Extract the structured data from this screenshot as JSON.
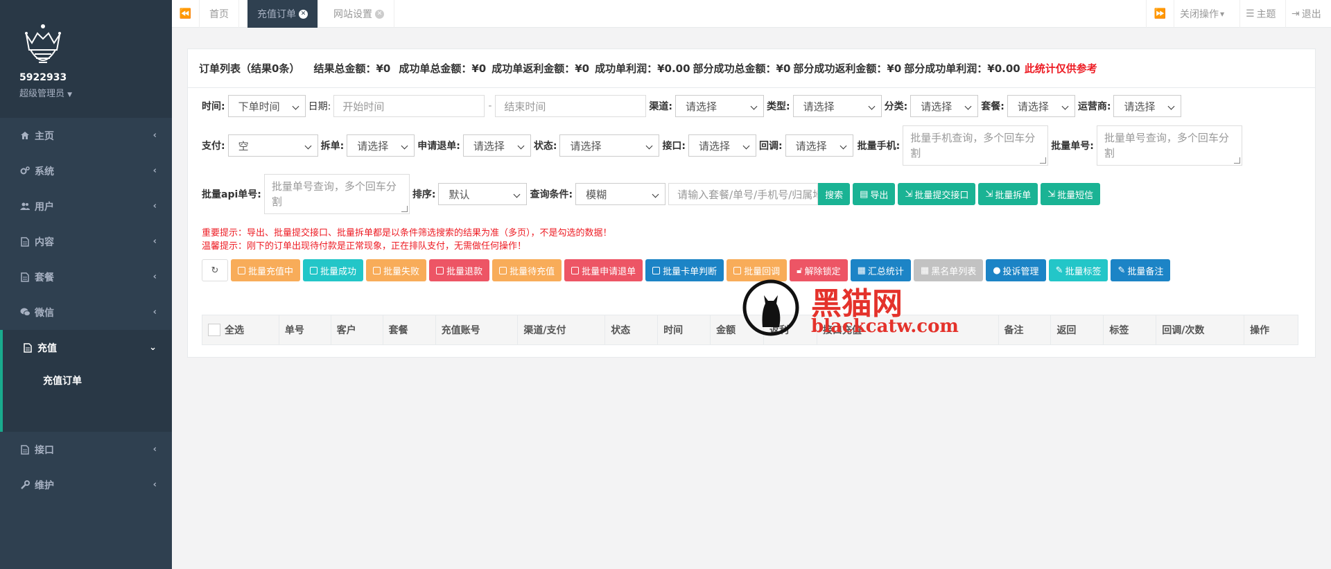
{
  "sidebar": {
    "username": "5922933",
    "role": "超级管理员",
    "items": [
      {
        "label": "主页",
        "icon": "home-icon"
      },
      {
        "label": "系统",
        "icon": "cogs-icon"
      },
      {
        "label": "用户",
        "icon": "users-icon"
      },
      {
        "label": "内容",
        "icon": "file-icon"
      },
      {
        "label": "套餐",
        "icon": "file-text-icon"
      },
      {
        "label": "微信",
        "icon": "chat-icon"
      },
      {
        "label": "充值",
        "icon": "file-text-icon",
        "active": true,
        "children": [
          "充值订单"
        ]
      },
      {
        "label": "接口",
        "icon": "file-icon"
      },
      {
        "label": "维护",
        "icon": "wrench-icon"
      }
    ]
  },
  "topbar": {
    "tabs": [
      {
        "label": "首页",
        "closable": false
      },
      {
        "label": "充值订单",
        "closable": true,
        "active": true
      },
      {
        "label": "网站设置",
        "closable": true
      }
    ],
    "close_ops": "关闭操作",
    "theme": "主题",
    "logout": "退出"
  },
  "summary": {
    "title": "订单列表（结果0条）",
    "total_amount": "结果总金额：¥0",
    "success_total": "成功单总金额：¥0",
    "success_rebate": "成功单返利金额：¥0",
    "success_profit": "成功单利润：¥0.00",
    "partial_total": "部分成功总金额：¥0",
    "partial_rebate": "部分成功返利金额：¥0",
    "partial_profit": "部分成功单利润：¥0.00",
    "note": "此统计仅供参考"
  },
  "filters": {
    "time_label": "时间:",
    "time_value": "下单时间",
    "date_label": "日期:",
    "start_placeholder": "开始时间",
    "dash": "-",
    "end_placeholder": "结束时间",
    "channel_label": "渠道:",
    "type_label": "类型:",
    "category_label": "分类:",
    "package_label": "套餐:",
    "operator_label": "运营商:",
    "please_select": "请选择",
    "pay_label": "支付:",
    "pay_value": "空",
    "split_label": "拆单:",
    "refund_label": "申请退单:",
    "status_label": "状态:",
    "api_label": "接口:",
    "callback_label": "回调:",
    "batch_phone_label": "批量手机:",
    "batch_phone_placeholder": "批量手机查询，多个回车分割",
    "batch_order_label": "批量单号:",
    "batch_order_placeholder": "批量单号查询，多个回车分割",
    "batch_api_label": "批量api单号:",
    "batch_api_placeholder": "批量单号查询，多个回车分割",
    "sort_label": "排序:",
    "sort_value": "默认",
    "query_label": "查询条件:",
    "query_value": "模糊",
    "keyword_placeholder": "请输入套餐/单号/手机号/归属地"
  },
  "search_buttons": [
    {
      "label": "搜索",
      "icon": ""
    },
    {
      "label": "导出",
      "icon": "file-icon"
    },
    {
      "label": "批量提交接口",
      "icon": "sign-in-icon"
    },
    {
      "label": "批量拆单",
      "icon": "sign-in-icon"
    },
    {
      "label": "批量短信",
      "icon": "sign-in-icon"
    }
  ],
  "tips": {
    "important": "重要提示：导出、批量提交接口、批量拆单都是以条件筛选搜索的结果为准（多页），不是勾选的数据！",
    "warm": "温馨提示：刚下的订单出现待付款是正常现象，正在排队支付，无需做任何操作！"
  },
  "batch_buttons": [
    {
      "label": "批量充值中",
      "color": "orange"
    },
    {
      "label": "批量成功",
      "color": "cyan"
    },
    {
      "label": "批量失败",
      "color": "orange"
    },
    {
      "label": "批量退款",
      "color": "red"
    },
    {
      "label": "批量待充值",
      "color": "orange"
    },
    {
      "label": "批量申请退单",
      "color": "red"
    },
    {
      "label": "批量卡单判断",
      "color": "blue"
    },
    {
      "label": "批量回调",
      "color": "orange"
    },
    {
      "label": "解除锁定",
      "color": "red"
    },
    {
      "label": "汇总统计",
      "color": "blue"
    },
    {
      "label": "黑名单列表",
      "color": "grey"
    },
    {
      "label": "投诉管理",
      "color": "blue"
    },
    {
      "label": "批量标签",
      "color": "cyan"
    },
    {
      "label": "批量备注",
      "color": "blue"
    }
  ],
  "table": {
    "columns": [
      "全选",
      "单号",
      "客户",
      "套餐",
      "充值账号",
      "渠道/支付",
      "状态",
      "时间",
      "金额",
      "返利",
      "接口充值",
      "备注",
      "返回",
      "标签",
      "回调/次数",
      "操作"
    ]
  },
  "watermark": {
    "cn": "黑猫网",
    "en": "blackcatw.com"
  },
  "colors": {
    "sidebar": "#2f4050",
    "accent": "#1ab394",
    "danger": "#ed5565",
    "warning": "#f8ac59",
    "info": "#23c6c8",
    "primary": "#1c84c6"
  }
}
